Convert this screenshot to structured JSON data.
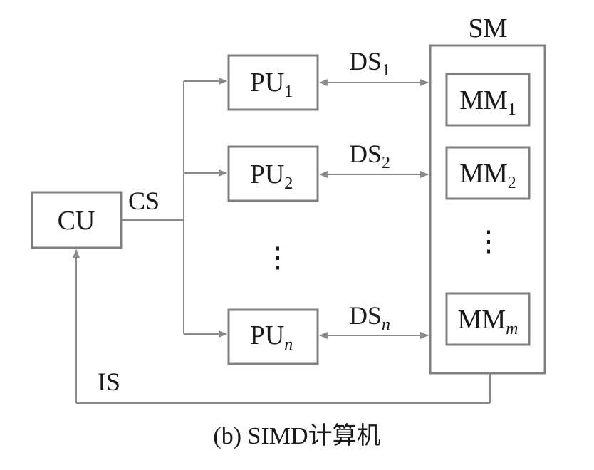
{
  "diagram": {
    "caption": "(b) SIMD计算机",
    "nodes": {
      "cu": {
        "label": "CU"
      },
      "pu1": {
        "label": "PU",
        "sub": "1"
      },
      "pu2": {
        "label": "PU",
        "sub": "2"
      },
      "pun": {
        "label": "PU",
        "sub": "n"
      },
      "sm": {
        "label": "SM"
      },
      "mm1": {
        "label": "MM",
        "sub": "1"
      },
      "mm2": {
        "label": "MM",
        "sub": "2"
      },
      "mmm": {
        "label": "MM",
        "sub": "m"
      }
    },
    "edges": {
      "cs": {
        "label": "CS"
      },
      "ds1": {
        "label": "DS",
        "sub": "1"
      },
      "ds2": {
        "label": "DS",
        "sub": "2"
      },
      "dsn": {
        "label": "DS",
        "sub": "n"
      },
      "is": {
        "label": "IS"
      }
    },
    "ellipsis": {
      "pu_column": "⋮",
      "mm_column": "⋮"
    },
    "colors": {
      "box_stroke": "#7f7f7f",
      "line": "#8a8a8a",
      "text": "#1a1a1a"
    }
  }
}
